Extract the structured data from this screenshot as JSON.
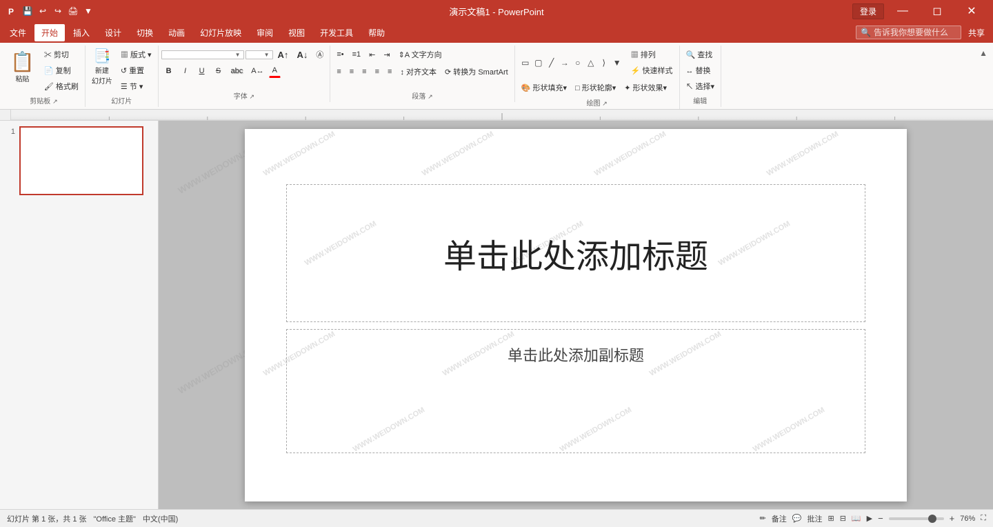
{
  "titlebar": {
    "app_title": "演示文稿1 - PowerPoint",
    "login_label": "登录",
    "share_label": "共享",
    "quick_access": [
      "save",
      "undo",
      "redo",
      "print-preview",
      "customize"
    ]
  },
  "menubar": {
    "items": [
      "文件",
      "开始",
      "插入",
      "设计",
      "切换",
      "动画",
      "幻灯片放映",
      "审阅",
      "视图",
      "开发工具",
      "帮助"
    ],
    "active": "开始",
    "search_placeholder": "告诉我你想要做什么"
  },
  "ribbon": {
    "groups": [
      {
        "name": "clipboard",
        "label": "剪贴板",
        "buttons": [
          "粘贴",
          "剪切",
          "复制",
          "格式刷"
        ]
      },
      {
        "name": "slides",
        "label": "幻灯片",
        "buttons": [
          "新建幻灯片",
          "版式",
          "重置",
          "节"
        ]
      },
      {
        "name": "font",
        "label": "字体",
        "font_name": "",
        "font_size": "",
        "buttons": [
          "B",
          "I",
          "U",
          "S",
          "A",
          "增大字号",
          "减小字号",
          "清除格式"
        ]
      },
      {
        "name": "paragraph",
        "label": "段落",
        "buttons": [
          "左对齐",
          "居中",
          "右对齐",
          "两端对齐",
          "分散对齐",
          "文字方向",
          "对齐文本"
        ]
      },
      {
        "name": "drawing",
        "label": "绘图",
        "buttons": [
          "排列",
          "快速样式",
          "形状填充",
          "形状轮廓",
          "形状效果",
          "选择"
        ]
      },
      {
        "name": "editing",
        "label": "编辑",
        "buttons": [
          "查找",
          "替换",
          "选择"
        ]
      }
    ]
  },
  "slide_panel": {
    "slide_number": "1"
  },
  "canvas": {
    "title_placeholder": "单击此处添加标题",
    "subtitle_placeholder": "单击此处添加副标题",
    "watermark": "WWW.WEIDOWN.COM"
  },
  "statusbar": {
    "slide_info": "幻灯片 第 1 张，共 1 张",
    "theme": "\"Office 主题\"",
    "language": "中文(中国)",
    "notes_label": "备注",
    "comments_label": "批注",
    "zoom_level": "76%"
  }
}
